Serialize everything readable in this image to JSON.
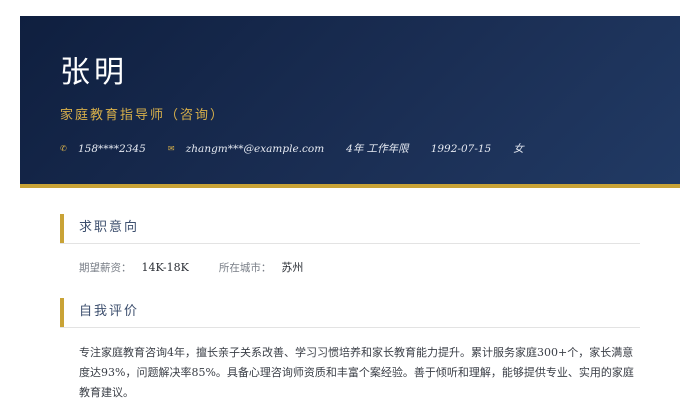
{
  "header": {
    "name": "张明",
    "job_title": "家庭教育指导师（咨询）",
    "contacts": [
      {
        "icon": "phone-icon",
        "glyph": "✆",
        "text": "158****2345"
      },
      {
        "icon": "mail-icon",
        "glyph": "✉",
        "text": "zhangm***@example.com"
      },
      {
        "icon": "",
        "glyph": "",
        "text": "4年 工作年限"
      },
      {
        "icon": "",
        "glyph": "",
        "text": "1992-07-15"
      },
      {
        "icon": "",
        "glyph": "",
        "text": "女"
      }
    ]
  },
  "job_intention": {
    "title": "求职意向",
    "salary_label": "期望薪资：",
    "salary_value": "14K-18K",
    "city_label": "所在城市：",
    "city_value": "苏州"
  },
  "self_evaluation": {
    "title": "自我评价",
    "text": "专注家庭教育咨询4年，擅长亲子关系改善、学习习惯培养和家长教育能力提升。累计服务家庭300+个，家长满意度达93%，问题解决率85%。具备心理咨询师资质和丰富个案经验。善于倾听和理解，能够提供专业、实用的家庭教育建议。"
  },
  "colors": {
    "header_bg": "#1b2f55",
    "accent_gold": "#c9a336"
  }
}
